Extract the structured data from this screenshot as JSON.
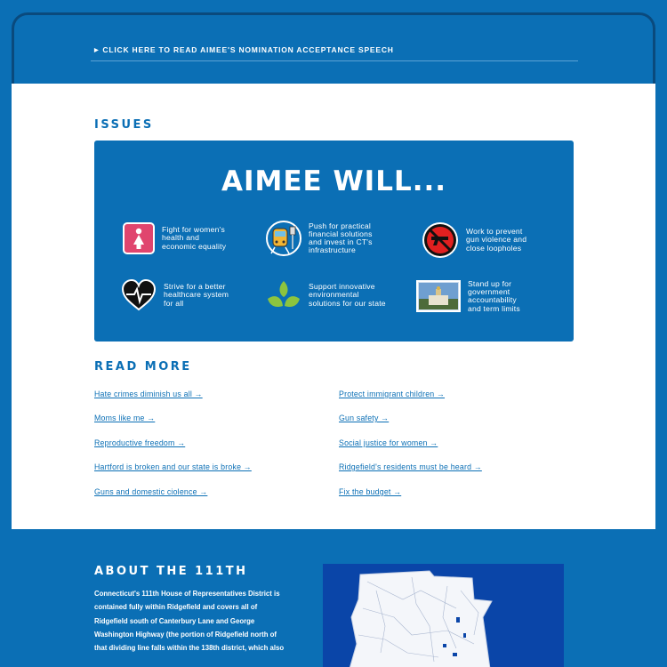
{
  "speech_link": "CLICK HERE TO READ AIMEE'S NOMINATION ACCEPTANCE SPEECH",
  "issues": {
    "heading": "ISSUES",
    "title": "AIMEE WILL...",
    "items": [
      {
        "icon": "woman-icon",
        "text": [
          "Fight for women's",
          "health and",
          "economic equality"
        ]
      },
      {
        "icon": "train-icon",
        "text": [
          "Push for practical",
          "financial solutions",
          "and invest in CT's",
          "infrastructure"
        ]
      },
      {
        "icon": "no-gun-icon",
        "text": [
          "Work to prevent",
          "gun violence and",
          "close loopholes"
        ]
      },
      {
        "icon": "heart-pulse-icon",
        "text": [
          "Strive for a better",
          "healthcare system",
          "for all"
        ]
      },
      {
        "icon": "leaf-icon",
        "text": [
          "Support innovative",
          "environmental",
          "solutions for our state"
        ]
      },
      {
        "icon": "capitol-photo-icon",
        "text": [
          "Stand up for",
          "government",
          "accountability",
          "and term limits"
        ]
      }
    ]
  },
  "read_more": {
    "heading": "READ MORE",
    "links": [
      "Hate crimes diminish us all →",
      "Protect immigrant children →",
      "Moms like me →",
      "Gun safety →",
      "Reproductive freedom →",
      "Social justice for women →",
      "Hartford is broken and our state is broke →",
      "Ridgefield's residents must be heard →",
      "Guns and domestic ciolence →",
      "Fix the budget →"
    ]
  },
  "about": {
    "heading": "ABOUT THE 111TH",
    "lines": [
      "Connecticut's 111th House of Representatives District is",
      "contained fully within Ridgefield and covers all of",
      "Ridgefield south of Canterbury Lane and George",
      "Washington Highway (the portion of Ridgefield north of",
      "that dividing line falls within the 138th district, which also"
    ]
  },
  "colors": {
    "brand_blue": "#0b6fb5",
    "map_blue": "#0a45a8",
    "icon_pink": "#e0456e",
    "icon_red": "#e02020",
    "icon_green": "#8cc43f"
  }
}
